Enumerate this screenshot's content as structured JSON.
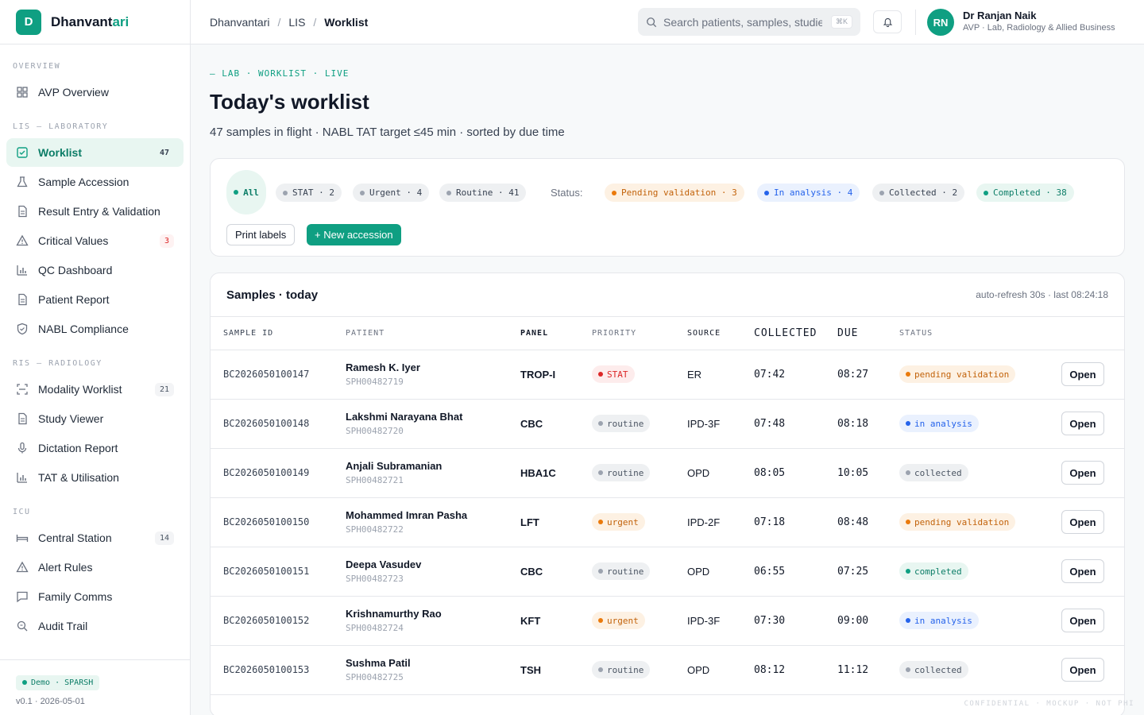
{
  "brand": {
    "initial": "D",
    "name_main": "Dhanvant",
    "name_accent": "ari"
  },
  "sidebar": {
    "sections": [
      {
        "title": "OVERVIEW",
        "items": [
          {
            "label": "AVP Overview",
            "icon": "grid-icon"
          }
        ]
      },
      {
        "title": "LIS — LABORATORY",
        "items": [
          {
            "label": "Worklist",
            "icon": "checkbox-icon",
            "count": "47",
            "active": true
          },
          {
            "label": "Sample Accession",
            "icon": "flask-icon"
          },
          {
            "label": "Result Entry & Validation",
            "icon": "document-icon"
          },
          {
            "label": "Critical Values",
            "icon": "warning-icon",
            "count": "3",
            "count_style": "red"
          },
          {
            "label": "QC Dashboard",
            "icon": "bar-chart-icon"
          },
          {
            "label": "Patient Report",
            "icon": "document-icon"
          },
          {
            "label": "NABL Compliance",
            "icon": "shield-icon"
          }
        ]
      },
      {
        "title": "RIS — RADIOLOGY",
        "items": [
          {
            "label": "Modality Worklist",
            "icon": "scan-icon",
            "count": "21"
          },
          {
            "label": "Study Viewer",
            "icon": "document-icon"
          },
          {
            "label": "Dictation Report",
            "icon": "microphone-icon"
          },
          {
            "label": "TAT & Utilisation",
            "icon": "bar-chart-icon"
          }
        ]
      },
      {
        "title": "ICU",
        "items": [
          {
            "label": "Central Station",
            "icon": "bed-icon",
            "count": "14"
          },
          {
            "label": "Alert Rules",
            "icon": "warning-icon"
          },
          {
            "label": "Family Comms",
            "icon": "chat-icon"
          },
          {
            "label": "Audit Trail",
            "icon": "search-doc-icon"
          }
        ]
      }
    ],
    "footer": {
      "badge": "Demo · SPARSH",
      "version": "v0.1 · 2026-05-01"
    }
  },
  "topbar": {
    "breadcrumb": [
      "Dhanvantari",
      "LIS",
      "Worklist"
    ],
    "search_placeholder": "Search patients, samples, studies",
    "search_kbd": "⌘K",
    "user": {
      "initials": "RN",
      "name": "Dr Ranjan Naik",
      "role": "AVP · Lab, Radiology & Allied Business"
    }
  },
  "page": {
    "eyebrow": "— LAB · WORKLIST · LIVE",
    "title": "Today's worklist",
    "subtitle": "47 samples in flight · NABL TAT target ≤45 min · sorted by due time"
  },
  "filters": {
    "priority": [
      {
        "label": "All",
        "style": "all",
        "dot": "#0f9f82"
      },
      {
        "label": "STAT · 2",
        "style": "gray",
        "dot": "#9ca3af"
      },
      {
        "label": "Urgent · 4",
        "style": "gray",
        "dot": "#9ca3af"
      },
      {
        "label": "Routine · 41",
        "style": "gray",
        "dot": "#9ca3af"
      }
    ],
    "status_label": "Status:",
    "status": [
      {
        "label": "Pending validation · 3",
        "style": "orange",
        "dot": "#ea7a0c"
      },
      {
        "label": "In analysis · 4",
        "style": "blue",
        "dot": "#2563eb"
      },
      {
        "label": "Collected · 2",
        "style": "gray",
        "dot": "#9ca3af"
      },
      {
        "label": "Completed · 38",
        "style": "green",
        "dot": "#0f9f82"
      }
    ],
    "print_label": "Print labels",
    "new_label": "+ New accession"
  },
  "samples": {
    "title": "Samples · today",
    "meta": "auto-refresh 30s · last 08:24:18",
    "columns": [
      "SAMPLE ID",
      "PATIENT",
      "PANEL",
      "PRIORITY",
      "SOURCE",
      "COLLECTED",
      "DUE",
      "STATUS"
    ],
    "open_label": "Open",
    "rows": [
      {
        "id": "BC2026050100147",
        "name": "Ramesh K. Iyer",
        "pid": "SPH00482719",
        "panel": "TROP-I",
        "priority": "STAT",
        "pri_style": "stat",
        "source": "ER",
        "collected": "07:42",
        "due": "08:27",
        "status": "pending validation",
        "status_style": "s-pending"
      },
      {
        "id": "BC2026050100148",
        "name": "Lakshmi Narayana Bhat",
        "pid": "SPH00482720",
        "panel": "CBC",
        "priority": "routine",
        "pri_style": "routine",
        "source": "IPD-3F",
        "collected": "07:48",
        "due": "08:18",
        "status": "in analysis",
        "status_style": "s-analysis"
      },
      {
        "id": "BC2026050100149",
        "name": "Anjali Subramanian",
        "pid": "SPH00482721",
        "panel": "HBA1C",
        "priority": "routine",
        "pri_style": "routine",
        "source": "OPD",
        "collected": "08:05",
        "due": "10:05",
        "status": "collected",
        "status_style": "s-collected"
      },
      {
        "id": "BC2026050100150",
        "name": "Mohammed Imran Pasha",
        "pid": "SPH00482722",
        "panel": "LFT",
        "priority": "urgent",
        "pri_style": "urgent",
        "source": "IPD-2F",
        "collected": "07:18",
        "due": "08:48",
        "status": "pending validation",
        "status_style": "s-pending"
      },
      {
        "id": "BC2026050100151",
        "name": "Deepa Vasudev",
        "pid": "SPH00482723",
        "panel": "CBC",
        "priority": "routine",
        "pri_style": "routine",
        "source": "OPD",
        "collected": "06:55",
        "due": "07:25",
        "status": "completed",
        "status_style": "s-completed"
      },
      {
        "id": "BC2026050100152",
        "name": "Krishnamurthy Rao",
        "pid": "SPH00482724",
        "panel": "KFT",
        "priority": "urgent",
        "pri_style": "urgent",
        "source": "IPD-3F",
        "collected": "07:30",
        "due": "09:00",
        "status": "in analysis",
        "status_style": "s-analysis"
      },
      {
        "id": "BC2026050100153",
        "name": "Sushma Patil",
        "pid": "SPH00482725",
        "panel": "TSH",
        "priority": "routine",
        "pri_style": "routine",
        "source": "OPD",
        "collected": "08:12",
        "due": "11:12",
        "status": "collected",
        "status_style": "s-collected"
      }
    ]
  },
  "watermark": "CONFIDENTIAL · MOCKUP · NOT PHI",
  "colors": {
    "accent": "#0f9f82",
    "stat": "#dc2626",
    "urgent": "#ea7a0c",
    "analysis": "#2563eb",
    "neutral": "#9ca3af"
  }
}
